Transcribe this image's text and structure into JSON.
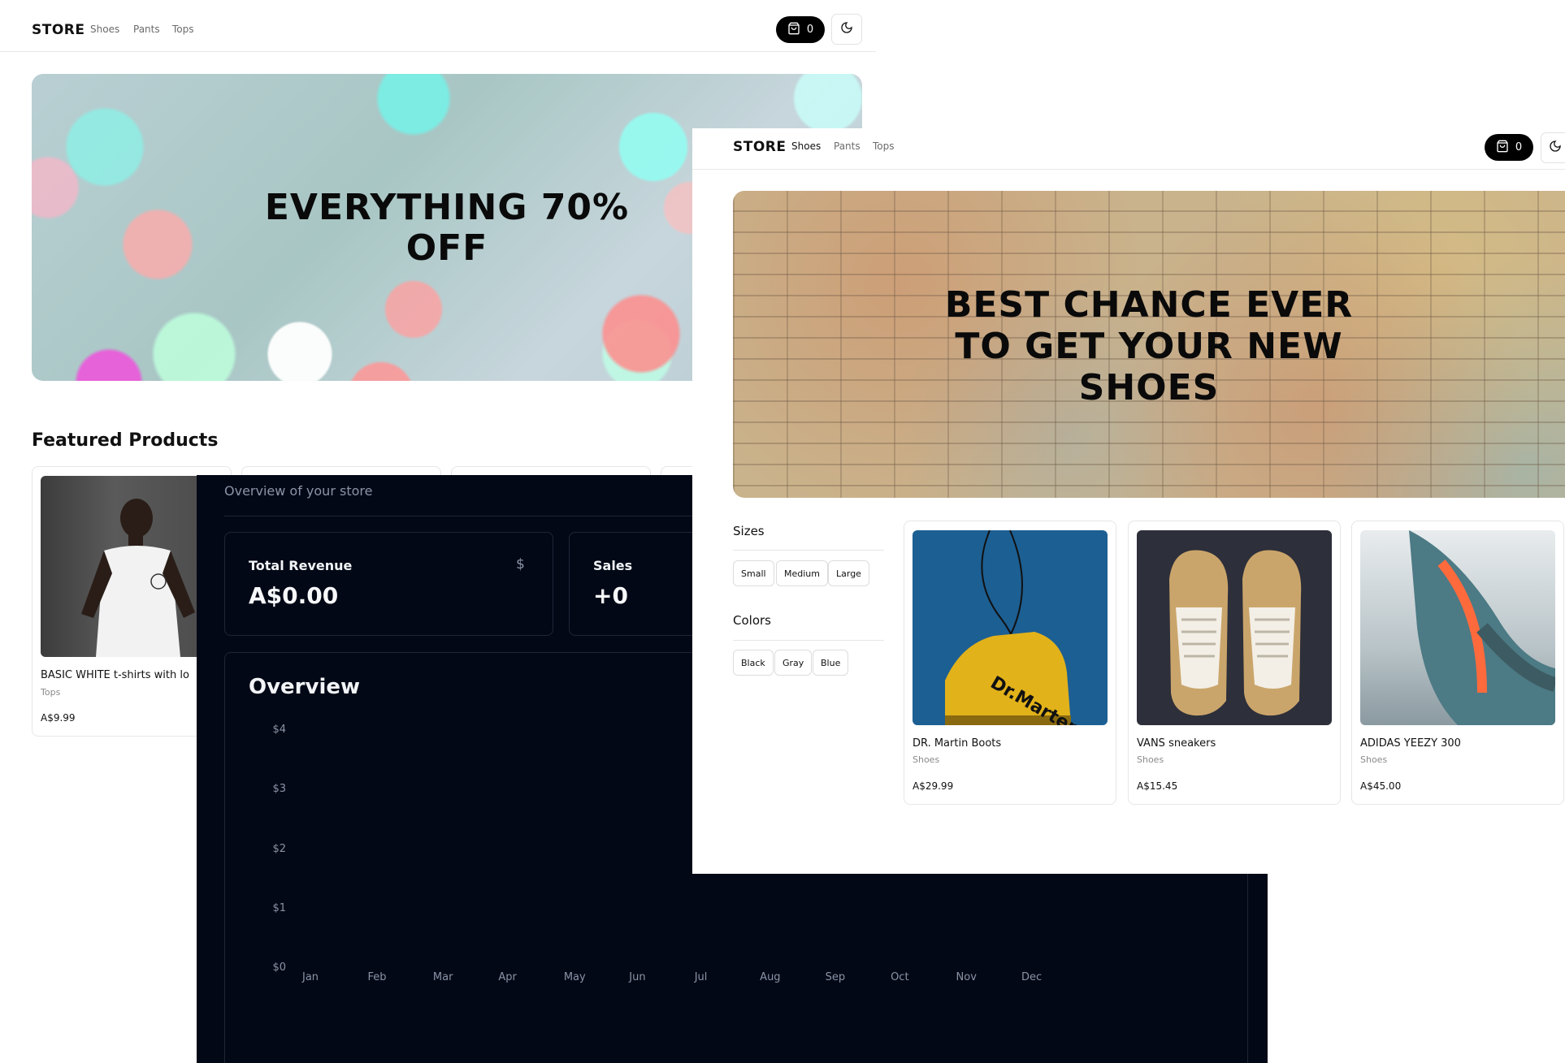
{
  "store_home": {
    "nav": {
      "logo": "STORE",
      "links": [
        "Shoes",
        "Pants",
        "Tops"
      ],
      "cart_count": "0"
    },
    "hero": {
      "title_line1": "EVERYTHING 70%",
      "title_line2": "OFF"
    },
    "featured": {
      "heading": "Featured Products",
      "products": [
        {
          "name": "BASIC WHITE t-shirts with lo",
          "category": "Tops",
          "price": "A$9.99"
        }
      ]
    }
  },
  "dashboard": {
    "subtitle": "Overview of your store",
    "cards": [
      {
        "label": "Total Revenue",
        "value": "A$0.00",
        "icon": "dollar-icon",
        "icon_glyph": "$"
      },
      {
        "label": "Sales",
        "value": "+0"
      }
    ],
    "overview_heading": "Overview",
    "chart_data": {
      "type": "bar",
      "categories": [
        "Jan",
        "Feb",
        "Mar",
        "Apr",
        "May",
        "Jun",
        "Jul",
        "Aug",
        "Sep",
        "Oct",
        "Nov",
        "Dec"
      ],
      "values": [
        0,
        0,
        0,
        0,
        0,
        0,
        0,
        0,
        0,
        0,
        0,
        0
      ],
      "y_ticks": [
        "$4",
        "$3",
        "$2",
        "$1",
        "$0"
      ],
      "ylim": [
        0,
        4
      ],
      "title": "Overview",
      "grid": false
    }
  },
  "shoes_page": {
    "nav": {
      "logo": "STORE",
      "links": [
        "Shoes",
        "Pants",
        "Tops"
      ],
      "active": "Shoes",
      "cart_count": "0"
    },
    "hero": {
      "title_line1": "BEST CHANCE EVER",
      "title_line2": "TO GET YOUR NEW",
      "title_line3": "SHOES"
    },
    "filters": {
      "sizes_heading": "Sizes",
      "sizes": [
        "Small",
        "Medium",
        "Large"
      ],
      "colors_heading": "Colors",
      "colors": [
        "Black",
        "Gray",
        "Blue"
      ]
    },
    "products": [
      {
        "name": "DR. Martin Boots",
        "category": "Shoes",
        "price": "A$29.99"
      },
      {
        "name": "VANS sneakers",
        "category": "Shoes",
        "price": "A$15.45"
      },
      {
        "name": "ADIDAS YEEZY 300",
        "category": "Shoes",
        "price": "A$45.00"
      }
    ]
  },
  "colors": {
    "accent_dark": "#000000",
    "dashboard_bg": "#030816",
    "muted_text": "#8a94a6"
  }
}
